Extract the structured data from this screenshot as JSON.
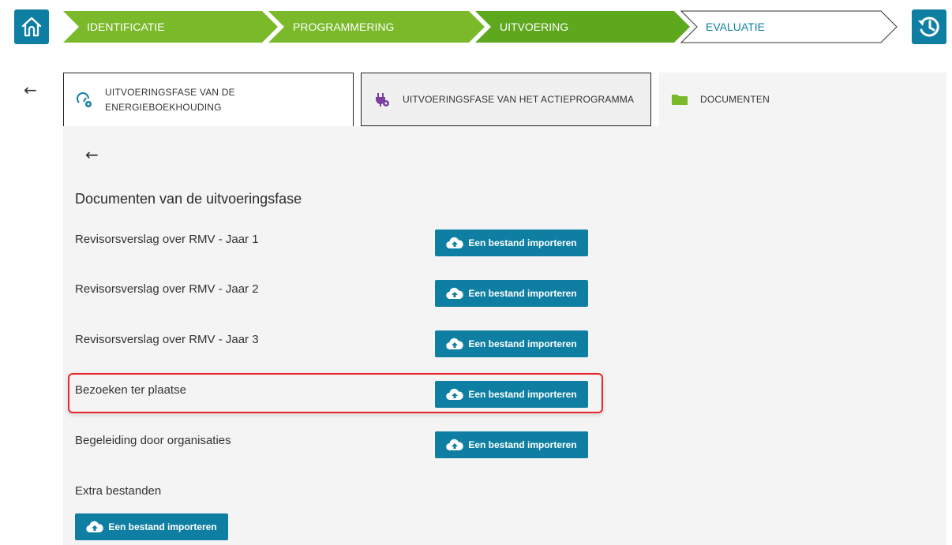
{
  "colors": {
    "accent": "#0e7fa3",
    "active_phase": "#7ab929",
    "highlight": "#e8262a"
  },
  "header": {
    "home_icon": "home-icon",
    "history_icon": "history-icon",
    "phases": [
      "IDENTIFICATIE",
      "PROGRAMMERING",
      "UITVOERING",
      "EVALUATIE"
    ]
  },
  "tabs": [
    {
      "line1": "UITVOERINGSFASE VAN DE",
      "line2": "ENERGIEBOEKHOUDING",
      "icon": "gauge-gear-icon"
    },
    {
      "line1": "UITVOERINGSFASE VAN HET ACTIEPROGRAMMA",
      "icon": "plug-gear-icon"
    },
    {
      "line1": "DOCUMENTEN",
      "icon": "folder-icon"
    }
  ],
  "main": {
    "title": "Documenten van de uitvoeringsfase",
    "import_label": "Een bestand importeren",
    "rows": [
      {
        "label": "Revisorsverslag over RMV - Jaar 1"
      },
      {
        "label": "Revisorsverslag over RMV - Jaar 2"
      },
      {
        "label": "Revisorsverslag over RMV - Jaar 3"
      },
      {
        "label": "Bezoeken ter plaatse"
      },
      {
        "label": "Begeleiding door organisaties"
      },
      {
        "label": "Extra bestanden"
      }
    ]
  }
}
